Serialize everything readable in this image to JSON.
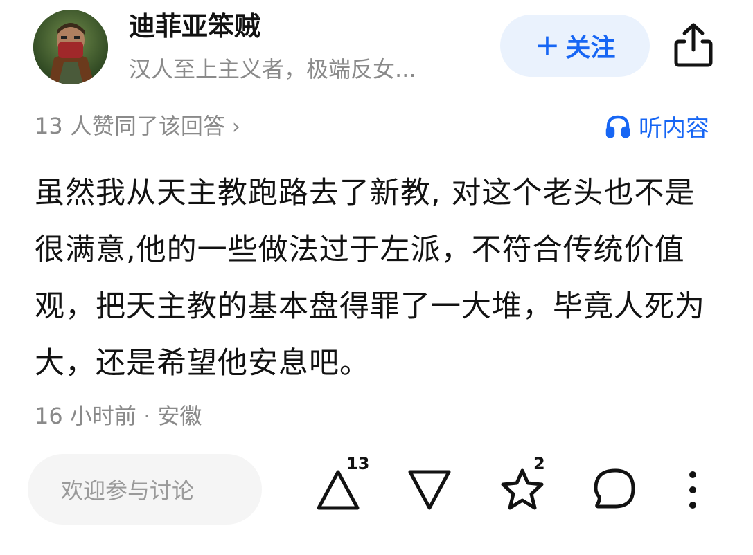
{
  "author": {
    "name": "迪菲亚笨贼",
    "bio": "汉人至上主义者，极端反女..."
  },
  "header": {
    "follow_label": "关注",
    "follow_icon": "plus-icon",
    "share_icon": "share-icon"
  },
  "meta": {
    "upvote_summary": "13 人赞同了该回答",
    "listen_label": "听内容",
    "listen_icon": "headphones-icon"
  },
  "answer": {
    "text": "虽然我从天主教跑路去了新教, 对这个老头也不是很满意,他的一些做法过于左派，不符合传统价值观，把天主教的基本盘得罪了一大堆，毕竟人死为大，还是希望他安息吧。",
    "time_location": "16 小时前 · 安徽"
  },
  "bottom_bar": {
    "comment_placeholder": "欢迎参与讨论",
    "upvote_count": "13",
    "favorite_count": "2",
    "icons": [
      "upvote-icon",
      "downvote-icon",
      "star-icon",
      "comment-icon",
      "more-icon"
    ]
  },
  "colors": {
    "accent": "#1766f4",
    "follow_bg": "#eaf2fd",
    "muted": "#8a8a8a",
    "input_bg": "#f5f5f5"
  }
}
